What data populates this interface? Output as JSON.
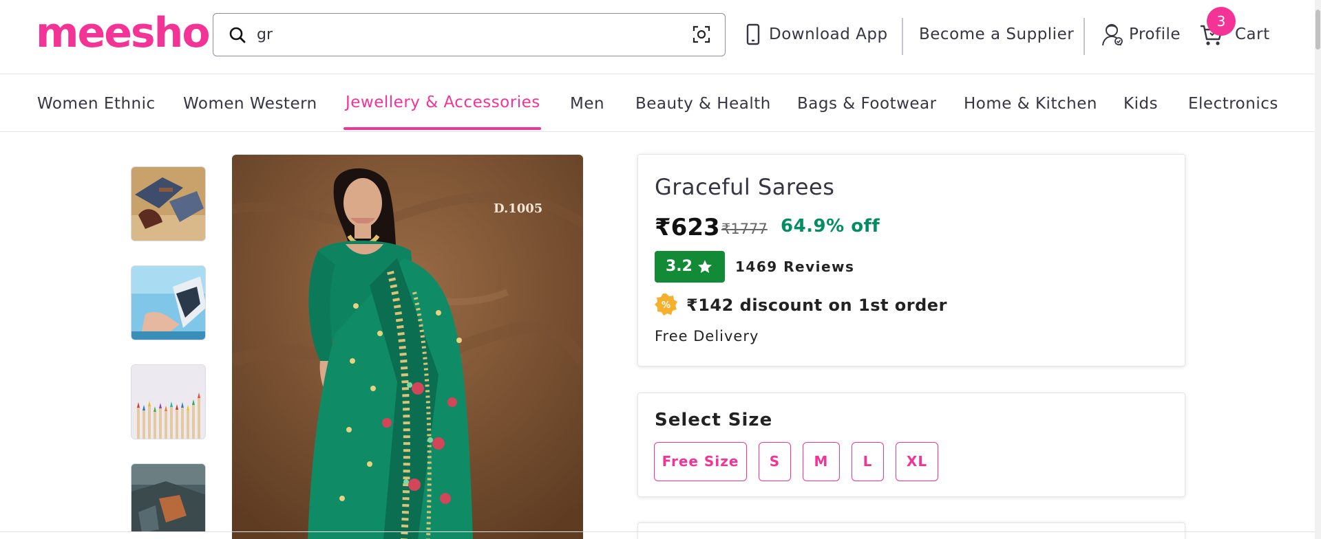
{
  "header": {
    "logo": "meesho",
    "search": {
      "value": "gr"
    },
    "download_app": "Download App",
    "become_supplier": "Become a Supplier",
    "profile": "Profile",
    "cart": "Cart",
    "cart_count": "3"
  },
  "categories": [
    {
      "label": "Women Ethnic"
    },
    {
      "label": "Women Western"
    },
    {
      "label": "Jewellery & Accessories"
    },
    {
      "label": "Men"
    },
    {
      "label": "Beauty & Health"
    },
    {
      "label": "Bags & Footwear"
    },
    {
      "label": "Home & Kitchen"
    },
    {
      "label": "Kids"
    },
    {
      "label": "Electronics"
    }
  ],
  "active_category": "Jewellery & Accessories",
  "product": {
    "title": "Graceful Sarees",
    "price": "₹623",
    "mrp": "₹1777",
    "discount_pct": "64.9% off",
    "rating": "3.2",
    "reviews": "1469 Reviews",
    "first_order_discount": "₹142 discount on 1st order",
    "delivery": "Free Delivery",
    "image_label": "D.1005"
  },
  "sizes": {
    "title": "Select Size",
    "options": [
      "Free Size",
      "S",
      "M",
      "L",
      "XL"
    ]
  },
  "colors": {
    "brand": "#f43397",
    "rating_green": "#138a36",
    "discount_green": "#038d63"
  },
  "icons": [
    "search-icon",
    "image-search-icon",
    "phone-icon",
    "profile-icon",
    "cart-icon",
    "star-icon",
    "discount-icon"
  ]
}
